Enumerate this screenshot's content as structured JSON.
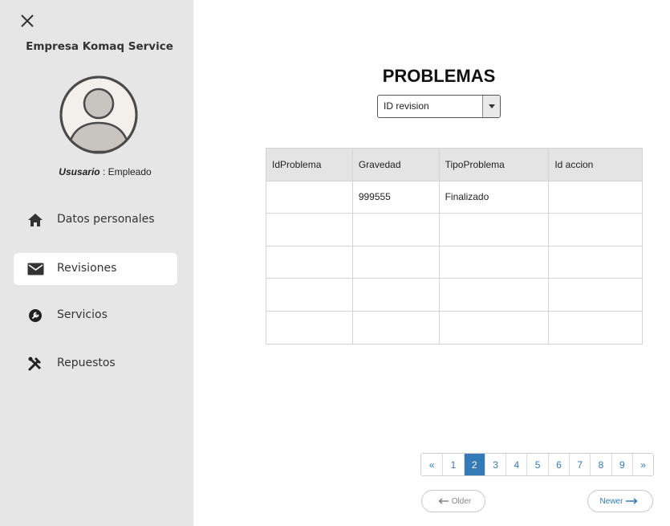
{
  "sidebar": {
    "company": "Empresa Komaq Service",
    "user_label": "Ususario",
    "user_separator": " : ",
    "user_role": "Empleado",
    "nav": [
      {
        "label": "Datos personales",
        "icon": "home-icon"
      },
      {
        "label": "Revisiones",
        "icon": "mail-icon"
      },
      {
        "label": "Servicios",
        "icon": "wrench-icon"
      },
      {
        "label": "Repuestos",
        "icon": "tools-icon"
      }
    ]
  },
  "main": {
    "title": "PROBLEMAS",
    "select_value": "ID revision",
    "table": {
      "headers": [
        "IdProblema",
        "Gravedad",
        "TipoProblema",
        "Id accion"
      ],
      "rows": [
        [
          "",
          "999555",
          "Finalizado",
          ""
        ],
        [
          "",
          "",
          "",
          ""
        ],
        [
          "",
          "",
          "",
          ""
        ],
        [
          "",
          "",
          "",
          ""
        ],
        [
          "",
          "",
          "",
          ""
        ]
      ]
    },
    "pagination": {
      "prev": "«",
      "pages": [
        "1",
        "2",
        "3",
        "4",
        "5",
        "6",
        "7",
        "8",
        "9"
      ],
      "next": "»",
      "current": "2"
    },
    "older_label": "Older",
    "newer_label": "Newer"
  },
  "colors": {
    "sidebar_bg": "#e6e6e6",
    "accent": "#337ab7"
  }
}
